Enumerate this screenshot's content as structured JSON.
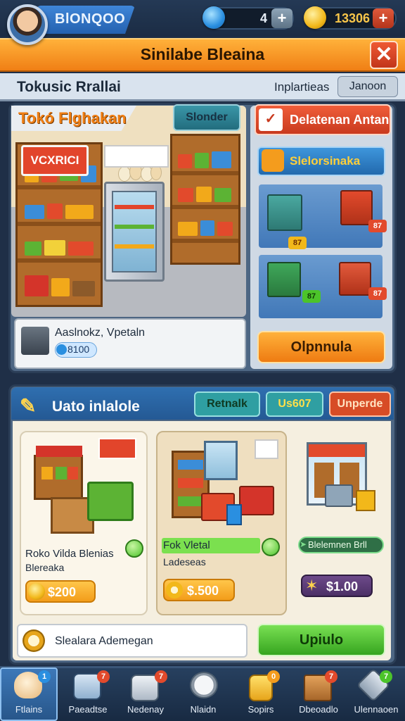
{
  "player": {
    "name": "BlONQOO"
  },
  "resources": {
    "gems": {
      "icon": "gem-icon",
      "value": "4"
    },
    "coins": {
      "icon": "coin-icon",
      "value": "13306"
    }
  },
  "banner": {
    "title": "Sinilabe Bleaina"
  },
  "subheader": {
    "title": "Tokusic Rrallai",
    "link": "Inplartieas",
    "button": "Janoon"
  },
  "shop": {
    "tab_label": "Tokó Flghakan",
    "tab_button": "Slonder",
    "store_sign": "VCXRICI",
    "info_name": "Aaslnokz, Vpetaln",
    "info_price": "8100",
    "right_button_1": "Delatenan Antan",
    "right_button_2": "Slelorsinaka",
    "building_badges": [
      "87",
      "87",
      "87",
      "87"
    ],
    "open_button": "Olpnnula"
  },
  "upgrade": {
    "title": "Uato inlalole",
    "tabs": [
      "Retnalk",
      "Us607",
      "Unperde"
    ],
    "cards": [
      {
        "name": "Roko Vilda Blenias",
        "sub": "Blereaka",
        "price": "$200"
      },
      {
        "name": "Fok Vletal",
        "sub": "Ladeseas",
        "price": "$.500"
      },
      {
        "name": "Blelemnen Brll",
        "sub": "",
        "price": "$1.00"
      }
    ],
    "footer_text": "Slealara Ademegan",
    "update_button": "Upiulo"
  },
  "nav": [
    {
      "label": "Ftlains",
      "badge": "1",
      "icon": "chicken-icon"
    },
    {
      "label": "Paeadtse",
      "badge": "7",
      "icon": "clipboard-icon"
    },
    {
      "label": "Nedenay",
      "badge": "7",
      "icon": "cart-icon"
    },
    {
      "label": "Nlaidn",
      "badge": "",
      "icon": "clock-icon"
    },
    {
      "label": "Sopirs",
      "badge": "0",
      "icon": "jar-icon"
    },
    {
      "label": "Dbeoadlo",
      "badge": "7",
      "icon": "crate-icon"
    },
    {
      "label": "Ulennaoen",
      "badge": "7",
      "icon": "tools-icon"
    }
  ],
  "colors": {
    "accent_orange": "#f07f15",
    "accent_blue": "#2f6fb0",
    "accent_green": "#36a51f",
    "panel": "#4d6683"
  }
}
